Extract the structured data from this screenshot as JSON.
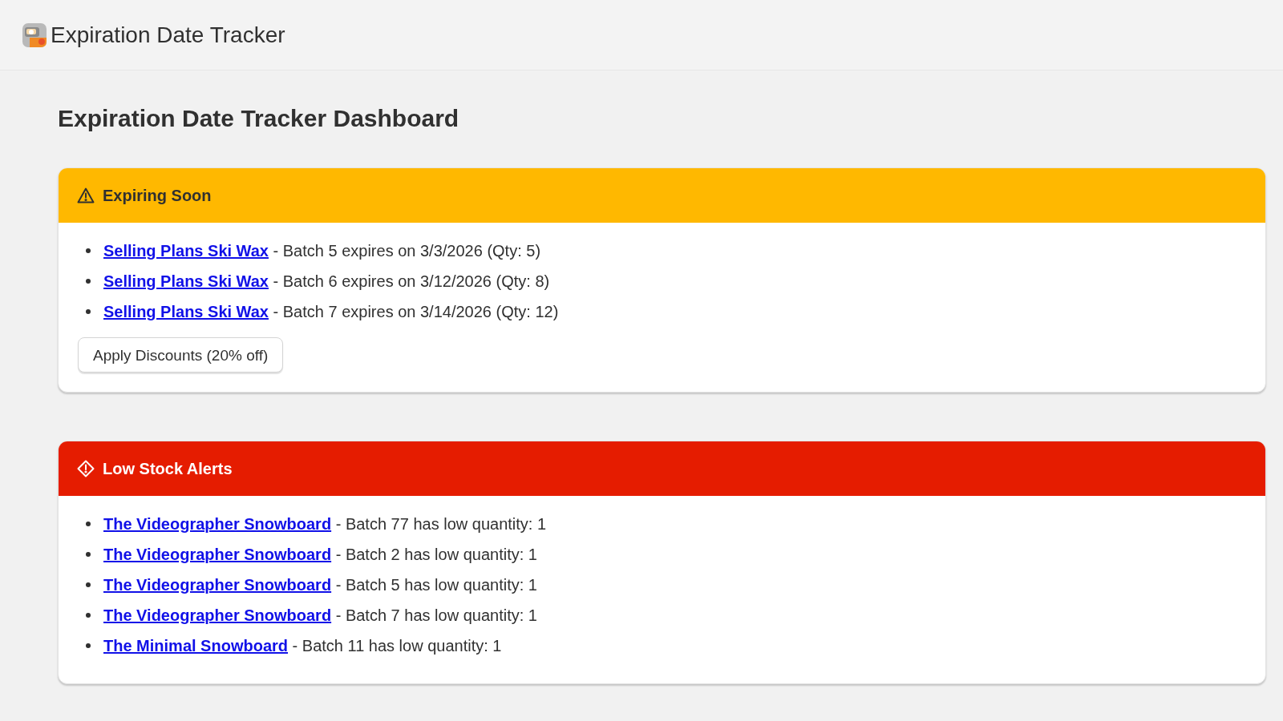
{
  "app_bar": {
    "title": "Expiration Date Tracker"
  },
  "page_title": "Expiration Date Tracker Dashboard",
  "sections": [
    {
      "kind": "warning",
      "title": "Expiring Soon",
      "items": [
        {
          "product": "Selling Plans Ski Wax",
          "detail": "- Batch 5 expires on 3/3/2026 (Qty: 5)"
        },
        {
          "product": "Selling Plans Ski Wax",
          "detail": "- Batch 6 expires on 3/12/2026 (Qty: 8)"
        },
        {
          "product": "Selling Plans Ski Wax",
          "detail": "- Batch 7 expires on 3/14/2026 (Qty: 12)"
        }
      ],
      "button": "Apply Discounts (20% off)"
    },
    {
      "kind": "critical",
      "title": "Low Stock Alerts",
      "items": [
        {
          "product": "The Videographer Snowboard",
          "detail": "- Batch 77 has low quantity: 1"
        },
        {
          "product": "The Videographer Snowboard",
          "detail": "- Batch 2 has low quantity: 1"
        },
        {
          "product": "The Videographer Snowboard",
          "detail": "- Batch 5 has low quantity: 1"
        },
        {
          "product": "The Videographer Snowboard",
          "detail": "- Batch 7 has low quantity: 1"
        },
        {
          "product": "The Minimal Snowboard",
          "detail": "- Batch 11 has low quantity: 1"
        }
      ]
    }
  ]
}
